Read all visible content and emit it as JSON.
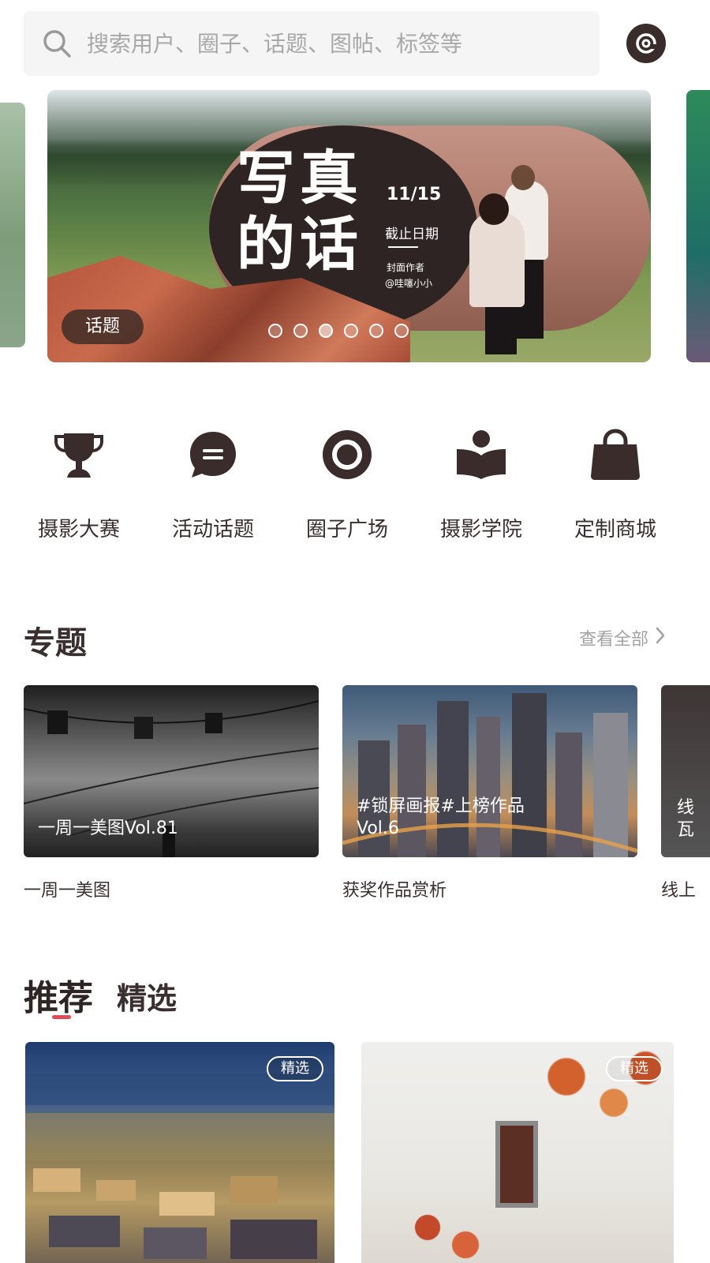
{
  "search": {
    "placeholder": "搜索用户、圈子、话题、图帖、标签等"
  },
  "banner": {
    "title_line1": "写真",
    "title_line2": "的话",
    "date": "11/15",
    "deadline": "截止日期",
    "cover_label": "封面作者",
    "cover_author": "@哇噻小小",
    "tag": "话题",
    "dots_total": 6,
    "dots_active_index": 2
  },
  "categories": [
    {
      "label": "摄影大赛",
      "icon": "trophy-icon"
    },
    {
      "label": "活动话题",
      "icon": "chat-bubble-icon"
    },
    {
      "label": "圈子广场",
      "icon": "ring-icon"
    },
    {
      "label": "摄影学院",
      "icon": "reader-book-icon"
    },
    {
      "label": "定制商城",
      "icon": "shopping-bag-icon"
    }
  ],
  "topics_section": {
    "title": "专题",
    "see_all": "查看全部",
    "items": [
      {
        "overlay": "一周一美图Vol.81",
        "caption": "一周一美图"
      },
      {
        "overlay_line1": "#锁屏画报#上榜作品",
        "overlay_line2": "Vol.6",
        "caption": "获奖作品赏析"
      },
      {
        "overlay_line1": "线",
        "overlay_line2": "瓦",
        "caption": "线上"
      }
    ]
  },
  "recommend": {
    "tab_active": "推荐",
    "tab_other": "精选",
    "cards": [
      {
        "badge": "精选"
      },
      {
        "badge": "精选"
      }
    ]
  },
  "colors": {
    "text_primary": "#3a2e2e",
    "accent_underline": "#e04b5a",
    "search_bg": "#f5f5f5",
    "icon_fill": "#3b2c2c"
  }
}
